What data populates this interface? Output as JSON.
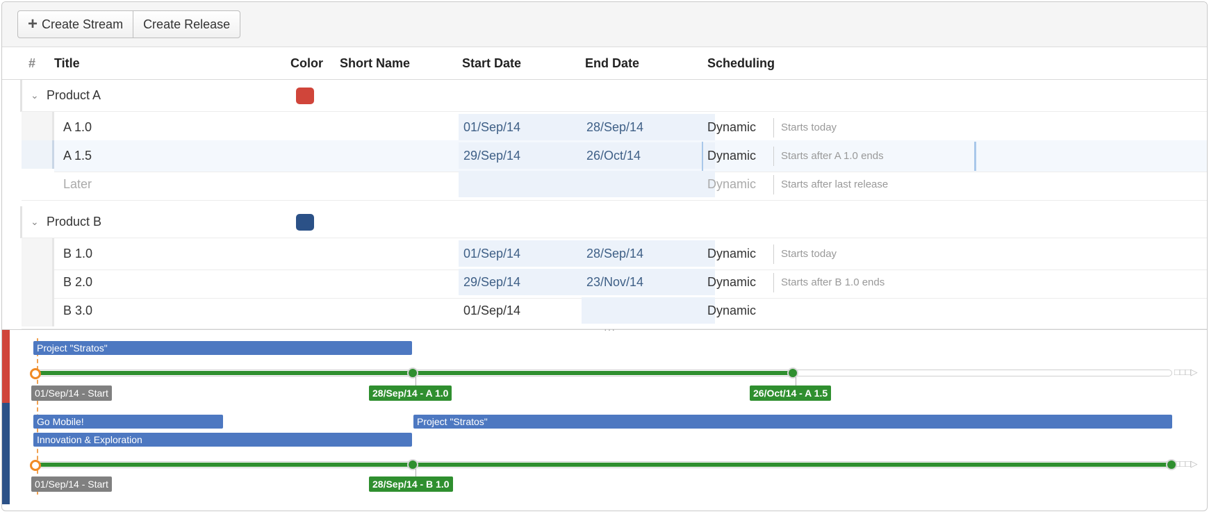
{
  "toolbar": {
    "create_stream": "Create Stream",
    "create_release": "Create Release",
    "plus_icon": "+"
  },
  "columns": {
    "num": "#",
    "title": "Title",
    "color": "Color",
    "short_name": "Short Name",
    "start_date": "Start Date",
    "end_date": "End Date",
    "scheduling": "Scheduling"
  },
  "groups": [
    {
      "title": "Product A",
      "color": "#d0453a",
      "rows": [
        {
          "title": "A 1.0",
          "start": "01/Sep/14",
          "end": "28/Sep/14",
          "scheduling": "Dynamic",
          "hint": "Starts today"
        },
        {
          "title": "A 1.5",
          "start": "29/Sep/14",
          "end": "26/Oct/14",
          "scheduling": "Dynamic",
          "hint": "Starts after A 1.0 ends"
        },
        {
          "title": "Later",
          "start": "",
          "end": "",
          "scheduling": "Dynamic",
          "hint": "Starts after last release"
        }
      ]
    },
    {
      "title": "Product B",
      "color": "#2b5187",
      "rows": [
        {
          "title": "B 1.0",
          "start": "01/Sep/14",
          "end": "28/Sep/14",
          "scheduling": "Dynamic",
          "hint": "Starts today"
        },
        {
          "title": "B 2.0",
          "start": "29/Sep/14",
          "end": "23/Nov/14",
          "scheduling": "Dynamic",
          "hint": "Starts after B 1.0 ends"
        },
        {
          "title": "B 3.0",
          "start": "01/Sep/14",
          "end": "",
          "scheduling": "Dynamic",
          "hint": ""
        }
      ]
    }
  ],
  "divider_handle": "···",
  "timeline": {
    "stream_a": {
      "color": "#d0453a",
      "bars": [
        {
          "label": "Project \"Stratos\""
        }
      ],
      "milestones": [
        {
          "label": "01/Sep/14 - Start"
        },
        {
          "label": "28/Sep/14 - A 1.0"
        },
        {
          "label": "26/Oct/14 - A 1.5"
        }
      ]
    },
    "stream_b": {
      "color": "#2b5187",
      "bars": [
        {
          "label": "Go Mobile!"
        },
        {
          "label": "Project \"Stratos\""
        },
        {
          "label": "Innovation & Exploration"
        }
      ],
      "milestones": [
        {
          "label": "01/Sep/14 - Start"
        },
        {
          "label": "28/Sep/14 - B 1.0"
        }
      ]
    },
    "endcap": "□□□▷"
  },
  "colors": {
    "bar_blue": "#4d78c1",
    "progress_green": "#2f8f2f",
    "today_orange": "#f08a24"
  }
}
